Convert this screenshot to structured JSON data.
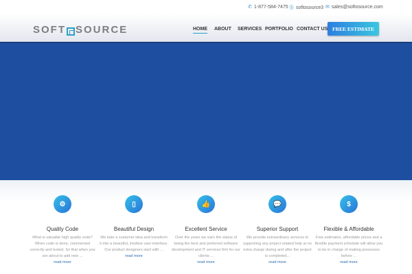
{
  "topbar": {
    "phone": "1-877-584-7475",
    "skype": "softosource3",
    "email": "sales@softosource.com"
  },
  "logo": {
    "text_left": "Soft",
    "text_right": "Source"
  },
  "nav": [
    {
      "label": "HOME"
    },
    {
      "label": "ABOUT"
    },
    {
      "label": "SERVICES"
    },
    {
      "label": "PORTFOLIO"
    },
    {
      "label": "CONTACT US"
    }
  ],
  "cta": "FREE ESTIMATE",
  "features": [
    {
      "icon": "gears",
      "glyph": "⚙",
      "title": "Quality Code",
      "desc": "What is valuable high quality code? When code is done, commented correctly and tested. So that when you are about to add new ...",
      "more": "read more"
    },
    {
      "icon": "mobile",
      "glyph": "▯",
      "title": "Beautiful Design",
      "desc": "We take a customer idea and transform it into a beautiful, intuitive user interface. Our product designers start with ...",
      "more": "read more"
    },
    {
      "icon": "thumbs-up",
      "glyph": "👍",
      "title": "Excellent Service",
      "desc": "Over the years we earn the status of being the best and preferred software development and IT services firm for our clients ...",
      "more": "read more"
    },
    {
      "icon": "chat",
      "glyph": "💬",
      "title": "Superior Support",
      "desc": "We provide extraordinary services in supporting any project related help at no extra charge during and after the project is completed...",
      "more": "read more"
    },
    {
      "icon": "dollar",
      "glyph": "$",
      "title": "Flexible & Affordable",
      "desc": "Free estimates, affordable prices and a flexible payment schedule will allow you to be in charge of making processes before ...",
      "more": "read more"
    }
  ]
}
